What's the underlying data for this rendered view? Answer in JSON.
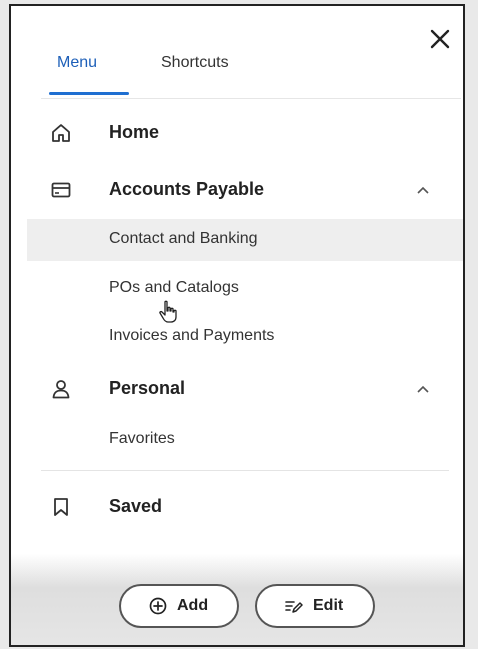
{
  "tabs": {
    "menu": "Menu",
    "shortcuts": "Shortcuts"
  },
  "menu": {
    "home": {
      "label": "Home",
      "icon": "home-icon"
    },
    "accounts_payable": {
      "label": "Accounts Payable",
      "icon": "card-icon",
      "items": [
        "Contact and Banking",
        "POs and Catalogs",
        "Invoices and Payments"
      ]
    },
    "personal": {
      "label": "Personal",
      "icon": "person-icon",
      "items": [
        "Favorites"
      ]
    },
    "saved": {
      "label": "Saved",
      "icon": "bookmark-icon"
    }
  },
  "footer": {
    "add_label": "Add",
    "edit_label": "Edit"
  },
  "colors": {
    "accent": "#1f6fd1"
  }
}
